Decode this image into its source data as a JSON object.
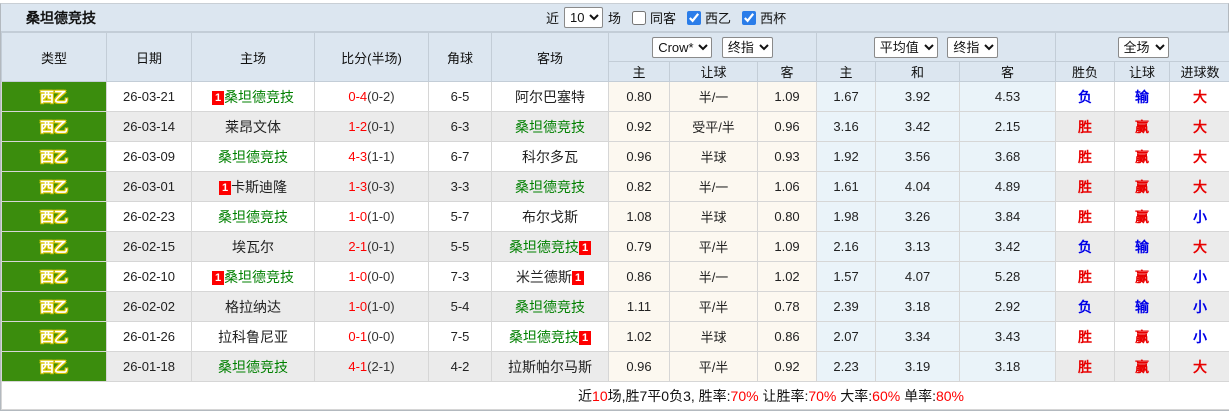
{
  "header": {
    "title": "桑坦德竞技",
    "controls": {
      "recent_label": "近",
      "recent_value": "10",
      "unit_label": "场",
      "same_away_label": "同客",
      "league_label": "西乙",
      "cup_label": "西杯"
    }
  },
  "table": {
    "left_headers": [
      "类型",
      "日期",
      "主场",
      "比分(半场)",
      "角球",
      "客场"
    ],
    "sub_headers": [
      "主",
      "让球",
      "客",
      "主",
      "和",
      "客",
      "胜负",
      "让球",
      "进球数"
    ],
    "dropdowns": {
      "asia_company": "Crow*",
      "asia_final": "终指",
      "europe_avg": "平均值",
      "europe_final": "终指",
      "scope": "全场"
    }
  },
  "rows": [
    {
      "type": "西乙",
      "date": "26-03-21",
      "home": "桑坦德竞技",
      "home_badge": "1",
      "home_main": true,
      "score_ft": "0-4",
      "score_ht": "(0-2)",
      "corner": "6-5",
      "away": "阿尔巴塞特",
      "away_badge": "",
      "away_main": false,
      "asia": [
        "0.80",
        "半/一",
        "1.09"
      ],
      "europe": [
        "1.67",
        "3.92",
        "4.53"
      ],
      "result": [
        "负",
        "输",
        "大"
      ]
    },
    {
      "type": "西乙",
      "date": "26-03-14",
      "home": "莱昂文体",
      "home_badge": "",
      "home_main": false,
      "score_ft": "1-2",
      "score_ht": "(0-1)",
      "corner": "6-3",
      "away": "桑坦德竞技",
      "away_badge": "",
      "away_main": true,
      "asia": [
        "0.92",
        "受平/半",
        "0.96"
      ],
      "europe": [
        "3.16",
        "3.42",
        "2.15"
      ],
      "result": [
        "胜",
        "赢",
        "大"
      ]
    },
    {
      "type": "西乙",
      "date": "26-03-09",
      "home": "桑坦德竞技",
      "home_badge": "",
      "home_main": true,
      "score_ft": "4-3",
      "score_ht": "(1-1)",
      "corner": "6-7",
      "away": "科尔多瓦",
      "away_badge": "",
      "away_main": false,
      "asia": [
        "0.96",
        "半球",
        "0.93"
      ],
      "europe": [
        "1.92",
        "3.56",
        "3.68"
      ],
      "result": [
        "胜",
        "赢",
        "大"
      ]
    },
    {
      "type": "西乙",
      "date": "26-03-01",
      "home": "卡斯迪隆",
      "home_badge": "1",
      "home_main": false,
      "score_ft": "1-3",
      "score_ht": "(0-3)",
      "corner": "3-3",
      "away": "桑坦德竞技",
      "away_badge": "",
      "away_main": true,
      "asia": [
        "0.82",
        "半/一",
        "1.06"
      ],
      "europe": [
        "1.61",
        "4.04",
        "4.89"
      ],
      "result": [
        "胜",
        "赢",
        "大"
      ]
    },
    {
      "type": "西乙",
      "date": "26-02-23",
      "home": "桑坦德竞技",
      "home_badge": "",
      "home_main": true,
      "score_ft": "1-0",
      "score_ht": "(1-0)",
      "corner": "5-7",
      "away": "布尔戈斯",
      "away_badge": "",
      "away_main": false,
      "asia": [
        "1.08",
        "半球",
        "0.80"
      ],
      "europe": [
        "1.98",
        "3.26",
        "3.84"
      ],
      "result": [
        "胜",
        "赢",
        "小"
      ]
    },
    {
      "type": "西乙",
      "date": "26-02-15",
      "home": "埃瓦尔",
      "home_badge": "",
      "home_main": false,
      "score_ft": "2-1",
      "score_ht": "(0-1)",
      "corner": "5-5",
      "away": "桑坦德竞技",
      "away_badge": "1",
      "away_main": true,
      "asia": [
        "0.79",
        "平/半",
        "1.09"
      ],
      "europe": [
        "2.16",
        "3.13",
        "3.42"
      ],
      "result": [
        "负",
        "输",
        "大"
      ]
    },
    {
      "type": "西乙",
      "date": "26-02-10",
      "home": "桑坦德竞技",
      "home_badge": "1",
      "home_main": true,
      "score_ft": "1-0",
      "score_ht": "(0-0)",
      "corner": "7-3",
      "away": "米兰德斯",
      "away_badge": "1",
      "away_main": false,
      "asia": [
        "0.86",
        "半/一",
        "1.02"
      ],
      "europe": [
        "1.57",
        "4.07",
        "5.28"
      ],
      "result": [
        "胜",
        "赢",
        "小"
      ]
    },
    {
      "type": "西乙",
      "date": "26-02-02",
      "home": "格拉纳达",
      "home_badge": "",
      "home_main": false,
      "score_ft": "1-0",
      "score_ht": "(1-0)",
      "corner": "5-4",
      "away": "桑坦德竞技",
      "away_badge": "",
      "away_main": true,
      "asia": [
        "1.11",
        "平/半",
        "0.78"
      ],
      "europe": [
        "2.39",
        "3.18",
        "2.92"
      ],
      "result": [
        "负",
        "输",
        "小"
      ]
    },
    {
      "type": "西乙",
      "date": "26-01-26",
      "home": "拉科鲁尼亚",
      "home_badge": "",
      "home_main": false,
      "score_ft": "0-1",
      "score_ht": "(0-0)",
      "corner": "7-5",
      "away": "桑坦德竞技",
      "away_badge": "1",
      "away_main": true,
      "asia": [
        "1.02",
        "半球",
        "0.86"
      ],
      "europe": [
        "2.07",
        "3.34",
        "3.43"
      ],
      "result": [
        "胜",
        "赢",
        "小"
      ]
    },
    {
      "type": "西乙",
      "date": "26-01-18",
      "home": "桑坦德竞技",
      "home_badge": "",
      "home_main": true,
      "score_ft": "4-1",
      "score_ht": "(2-1)",
      "corner": "4-2",
      "away": "拉斯帕尔马斯",
      "away_badge": "",
      "away_main": false,
      "asia": [
        "0.96",
        "平/半",
        "0.92"
      ],
      "europe": [
        "2.23",
        "3.19",
        "3.18"
      ],
      "result": [
        "胜",
        "赢",
        "大"
      ]
    }
  ],
  "footer": {
    "prefix": "近",
    "count": "10",
    "middle": "场,胜7平0负3, 胜率:",
    "win_rate": "70%",
    "let_label": " 让胜率:",
    "let_rate": "70%",
    "big_label": " 大率:",
    "big_rate": "60%",
    "single_label": " 单率:",
    "single_rate": "80%"
  }
}
